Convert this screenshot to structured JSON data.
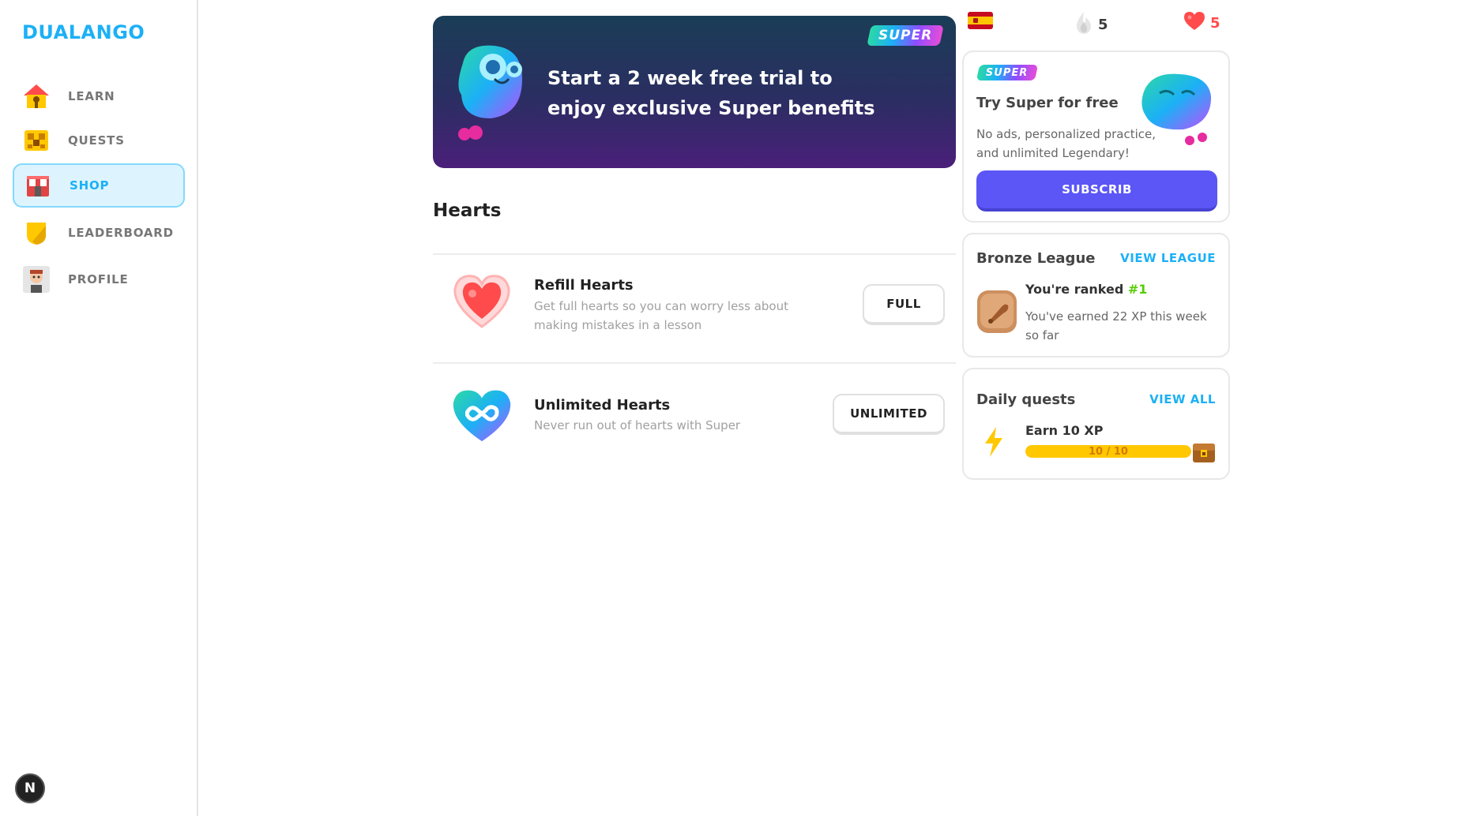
{
  "app": {
    "logo": "DUALANGO"
  },
  "sidebar": {
    "items": [
      {
        "label": "LEARN",
        "icon": "house-icon"
      },
      {
        "label": "QUESTS",
        "icon": "treasure-chest-icon"
      },
      {
        "label": "SHOP",
        "icon": "shop-icon",
        "active": true
      },
      {
        "label": "LEADERBOARD",
        "icon": "shield-icon"
      },
      {
        "label": "PROFILE",
        "icon": "avatar-icon"
      }
    ],
    "bottom_badge": "N"
  },
  "banner": {
    "badge": "SUPER",
    "title": "Start a 2 week free trial to enjoy exclusive Super benefits"
  },
  "hearts_section": {
    "title": "Hearts",
    "items": [
      {
        "title": "Refill Hearts",
        "description": "Get full hearts so you can worry less about making mistakes in a lesson",
        "button": "FULL",
        "icon": "heart-refill-icon"
      },
      {
        "title": "Unlimited Hearts",
        "description": "Never run out of hearts with Super",
        "button": "UNLIMITED",
        "icon": "infinity-heart-icon"
      }
    ]
  },
  "topbar": {
    "language_flag": "spain-flag-icon",
    "streak": "5",
    "hearts": "5"
  },
  "super_card": {
    "badge": "SUPER",
    "title": "Try Super for free",
    "description": "No ads, personalized practice, and unlimited Legendary!",
    "button": "SUBSCRIB"
  },
  "league_card": {
    "title": "Bronze League",
    "link": "VIEW LEAGUE",
    "ranked_prefix": "You're ranked ",
    "rank": "#1",
    "earned": "You've earned 22 XP this week so far"
  },
  "quests_card": {
    "title": "Daily quests",
    "link": "VIEW ALL",
    "quest_title": "Earn 10 XP",
    "progress_text": "10 / 10",
    "progress_fraction": 1.0
  },
  "colors": {
    "accent_blue": "#1cb0f6",
    "subscribe_purple": "#5b56f5",
    "heart_red": "#ff4b4b",
    "rank_green": "#58cc02",
    "progress_yellow": "#ffc800"
  }
}
